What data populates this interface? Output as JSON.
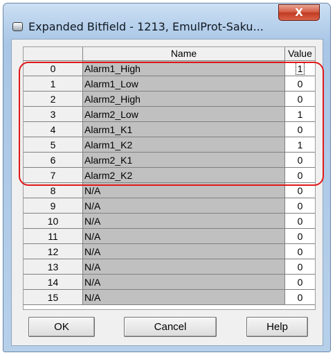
{
  "window": {
    "title": "Expanded Bitfield - 1213, EmulProt-Saku...",
    "close_label": "X"
  },
  "table": {
    "columns": [
      "",
      "Name",
      "Value"
    ],
    "rows": [
      {
        "index": "0",
        "name": "Alarm1_High",
        "value": "1"
      },
      {
        "index": "1",
        "name": "Alarm1_Low",
        "value": "0"
      },
      {
        "index": "2",
        "name": "Alarm2_High",
        "value": "0"
      },
      {
        "index": "3",
        "name": "Alarm2_Low",
        "value": "1"
      },
      {
        "index": "4",
        "name": "Alarm1_K1",
        "value": "0"
      },
      {
        "index": "5",
        "name": "Alarm1_K2",
        "value": "1"
      },
      {
        "index": "6",
        "name": "Alarm2_K1",
        "value": "0"
      },
      {
        "index": "7",
        "name": "Alarm2_K2",
        "value": "0"
      },
      {
        "index": "8",
        "name": "N/A",
        "value": "0"
      },
      {
        "index": "9",
        "name": "N/A",
        "value": "0"
      },
      {
        "index": "10",
        "name": "N/A",
        "value": "0"
      },
      {
        "index": "11",
        "name": "N/A",
        "value": "0"
      },
      {
        "index": "12",
        "name": "N/A",
        "value": "0"
      },
      {
        "index": "13",
        "name": "N/A",
        "value": "0"
      },
      {
        "index": "14",
        "name": "N/A",
        "value": "0"
      },
      {
        "index": "15",
        "name": "N/A",
        "value": "0"
      }
    ]
  },
  "buttons": {
    "ok": "OK",
    "cancel": "Cancel",
    "help": "Help"
  },
  "icons": {
    "title_icon": "window-app-icon",
    "close_icon": "close-icon"
  },
  "colors": {
    "highlight_outline": "#e01818",
    "close_button": "#c13a21",
    "name_column_bg": "#c0c0c0"
  }
}
